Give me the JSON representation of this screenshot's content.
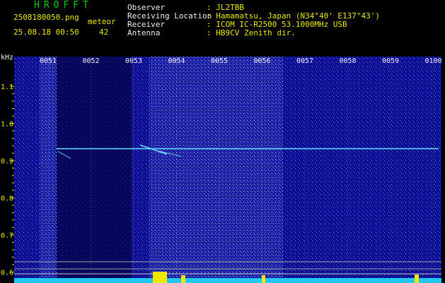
{
  "header": {
    "brand": "HROFFT",
    "filename": "2508180050.png",
    "datetime": "25.08.18 00:50",
    "meteor_label": "meteor",
    "meteor_count": "42",
    "info": [
      {
        "label": "Observer",
        "value": ": JL2TBB"
      },
      {
        "label": "Receiving Location",
        "value": ": Hamamatsu, Japan (N34°40' E137°43')"
      },
      {
        "label": "Receiver",
        "value": ": ICOM IC-R2500 53.1000MHz USB"
      },
      {
        "label": "Antenna",
        "value": ": HB9CV Zenith dir."
      }
    ]
  },
  "colors": {
    "text_yellow": "#e8e800",
    "text_white": "#f0f0f0",
    "brand_green": "#00d000",
    "background_blue": "#0a0a8a",
    "trace_cyan": "#60e0ff"
  },
  "chart_data": {
    "type": "heatmap",
    "y_unit": "kHz",
    "x_ticks": [
      "0051",
      "0052",
      "0053",
      "0054",
      "0055",
      "0056",
      "0057",
      "0058",
      "0059",
      "0100"
    ],
    "y_ticks": [
      "1.1",
      "1.0",
      "0.9",
      "0.8",
      "0.7",
      "0.6"
    ],
    "y_range": [
      0.58,
      1.18
    ],
    "carrier_khz": 0.932,
    "grid": true
  }
}
